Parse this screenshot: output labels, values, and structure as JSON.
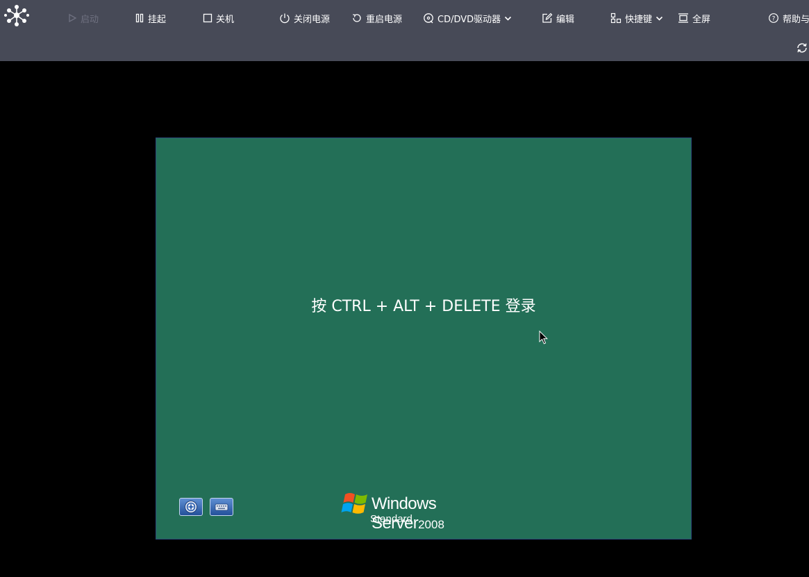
{
  "toolbar": {
    "start_label": "启动",
    "suspend_label": "挂起",
    "shutdown_label": "关机",
    "power_off_label": "关闭电源",
    "restart_power_label": "重启电源",
    "cd_dvd_label": "CD/DVD驱动器",
    "edit_label": "编辑",
    "shortcut_label": "快捷键",
    "fullscreen_label": "全屏",
    "help_label": "帮助与"
  },
  "console": {
    "cad_message": "按 CTRL + ALT + DELETE 登录",
    "brand_name": "Windows Server",
    "brand_version": "2008",
    "brand_edition": "Standard"
  },
  "colors": {
    "toolbar_bg": "#474a57",
    "console_bg": "#236f57",
    "disabled_text": "#6f7180"
  }
}
